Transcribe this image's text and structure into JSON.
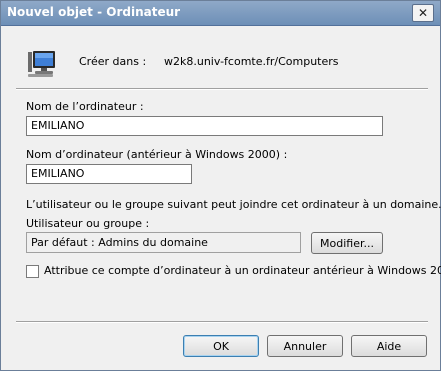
{
  "window": {
    "title": "Nouvel objet - Ordinateur",
    "close_label": "✕"
  },
  "header": {
    "create_in_label": "Créer dans :",
    "create_in_value": "w2k8.univ-fcomte.fr/Computers"
  },
  "fields": {
    "computer_name_label": "Nom de l’ordinateur :",
    "computer_name_value": "EMILIANO",
    "pre2000_label": "Nom d’ordinateur (antérieur à Windows 2000) :",
    "pre2000_value": "EMILIANO"
  },
  "join": {
    "description": "L’utilisateur ou le groupe suivant peut joindre cet ordinateur à un domaine.",
    "user_group_label": "Utilisateur ou groupe :",
    "user_group_value": "Par défaut : Admins du domaine",
    "modify_label": "Modifier..."
  },
  "checkbox": {
    "label": "Attribue ce compte d’ordinateur à un ordinateur antérieur à Windows 2000",
    "checked": false
  },
  "buttons": {
    "ok": "OK",
    "cancel": "Annuler",
    "help": "Aide"
  }
}
